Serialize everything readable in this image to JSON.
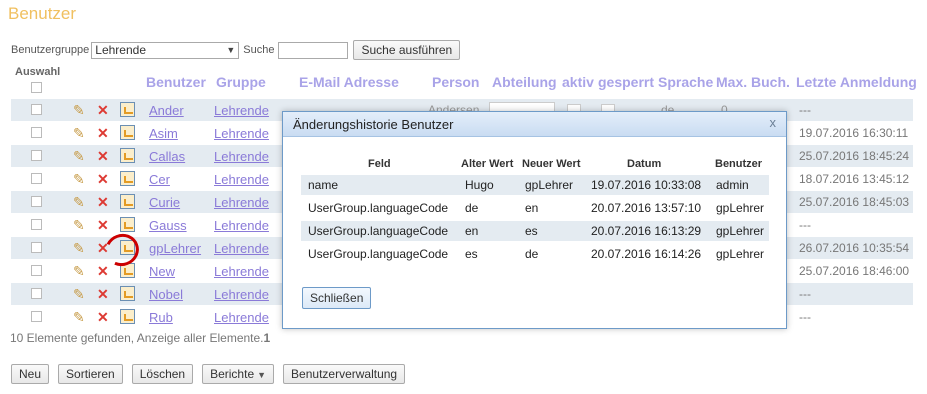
{
  "page": {
    "title": "Benutzer"
  },
  "filter": {
    "group_label": "Benutzergruppe",
    "group_value": "Lehrende",
    "search_label": "Suche",
    "search_value": "",
    "search_button": "Suche ausführen"
  },
  "table": {
    "select_label": "Auswahl",
    "columns": [
      "Benutzer",
      "Gruppe",
      "E-Mail Adresse",
      "Person",
      "Abteilung",
      "aktiv",
      "gesperrt",
      "Sprache",
      "Max. Buch.",
      "Letzte Anmeldung"
    ],
    "rows": [
      {
        "user": "Ander",
        "group": "Lehrende",
        "person": "Andersen",
        "language": "de",
        "max": "0",
        "last_login": "---"
      },
      {
        "user": "Asim",
        "group": "Lehrende",
        "person": "",
        "language": "",
        "max": "",
        "last_login": "19.07.2016 16:30:11"
      },
      {
        "user": "Callas",
        "group": "Lehrende",
        "person": "",
        "language": "",
        "max": "",
        "last_login": "25.07.2016 18:45:24"
      },
      {
        "user": "Cer",
        "group": "Lehrende",
        "person": "",
        "language": "",
        "max": "",
        "last_login": "18.07.2016 13:45:12"
      },
      {
        "user": "Curie",
        "group": "Lehrende",
        "person": "",
        "language": "",
        "max": "",
        "last_login": "25.07.2016 18:45:03"
      },
      {
        "user": "Gauss",
        "group": "Lehrende",
        "person": "",
        "language": "",
        "max": "",
        "last_login": "---"
      },
      {
        "user": "gpLehrer",
        "group": "Lehrende",
        "person": "",
        "language": "",
        "max": "",
        "last_login": "26.07.2016 10:35:54"
      },
      {
        "user": "New",
        "group": "Lehrende",
        "person": "",
        "language": "",
        "max": "",
        "last_login": "25.07.2016 18:46:00"
      },
      {
        "user": "Nobel",
        "group": "Lehrende",
        "person": "",
        "language": "",
        "max": "",
        "last_login": "---"
      },
      {
        "user": "Rub",
        "group": "Lehrende",
        "person": "",
        "language": "",
        "max": "",
        "last_login": "---"
      }
    ],
    "footer_prefix": "10 Elemente gefunden, Anzeige aller Elemente.",
    "footer_count": "1"
  },
  "buttons": {
    "new": "Neu",
    "sort": "Sortieren",
    "delete": "Löschen",
    "reports": "Berichte",
    "user_admin": "Benutzerverwaltung"
  },
  "dialog": {
    "title": "Änderungshistorie Benutzer",
    "close_icon": "x",
    "columns": [
      "Feld",
      "Alter Wert",
      "Neuer Wert",
      "Datum",
      "Benutzer"
    ],
    "rows": [
      {
        "field": "name",
        "old": "Hugo",
        "new": "gpLehrer",
        "date": "19.07.2016 10:33:08",
        "user": "admin"
      },
      {
        "field": "UserGroup.languageCode",
        "old": "de",
        "new": "en",
        "date": "20.07.2016 13:57:10",
        "user": "gpLehrer"
      },
      {
        "field": "UserGroup.languageCode",
        "old": "en",
        "new": "es",
        "date": "20.07.2016 16:13:29",
        "user": "gpLehrer"
      },
      {
        "field": "UserGroup.languageCode",
        "old": "es",
        "new": "de",
        "date": "20.07.2016 16:14:26",
        "user": "gpLehrer"
      }
    ],
    "close_button": "Schließen"
  },
  "colors": {
    "title": "#f0c060",
    "link": "#8a7ad8",
    "header": "#a9a3e8",
    "row_alt": "#e4ebf1",
    "highlight_circle": "#cc0000"
  },
  "icons": {
    "edit": "pencil-icon",
    "delete": "delete-x-icon",
    "history": "history-icon",
    "dialog_close": "close-icon",
    "dropdown": "chevron-down-icon"
  }
}
